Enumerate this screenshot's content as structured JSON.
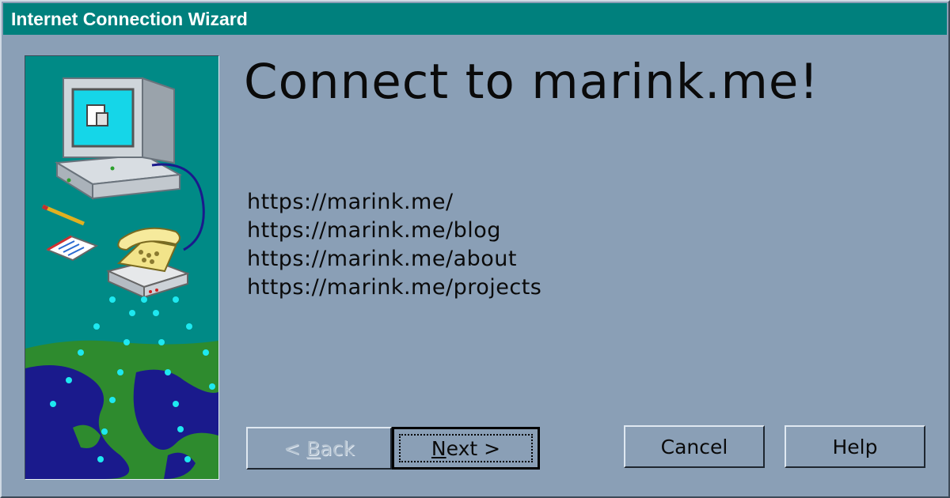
{
  "window": {
    "title": "Internet Connection Wizard"
  },
  "main": {
    "heading": "Connect to marink.me!",
    "links": [
      "https://marink.me/",
      "https://marink.me/blog",
      "https://marink.me/about",
      "https://marink.me/projects"
    ]
  },
  "buttons": {
    "back": {
      "prefix": "< ",
      "mnemonic": "B",
      "rest": "ack",
      "enabled": false
    },
    "next": {
      "mnemonic": "N",
      "rest": "ext >",
      "enabled": true,
      "focused": true
    },
    "cancel": "Cancel",
    "help": "Help"
  },
  "colors": {
    "titlebar": "#00807d",
    "window_bg": "#8a9fb6",
    "art_bg": "#008a86",
    "ocean": "#1a1a8c",
    "land": "#2e8b2e",
    "signal_dots": "#1ee8f0"
  },
  "icons": [
    "computer-icon",
    "telephone-modem-icon",
    "pencil-icon",
    "notepad-icon",
    "globe-icon"
  ]
}
